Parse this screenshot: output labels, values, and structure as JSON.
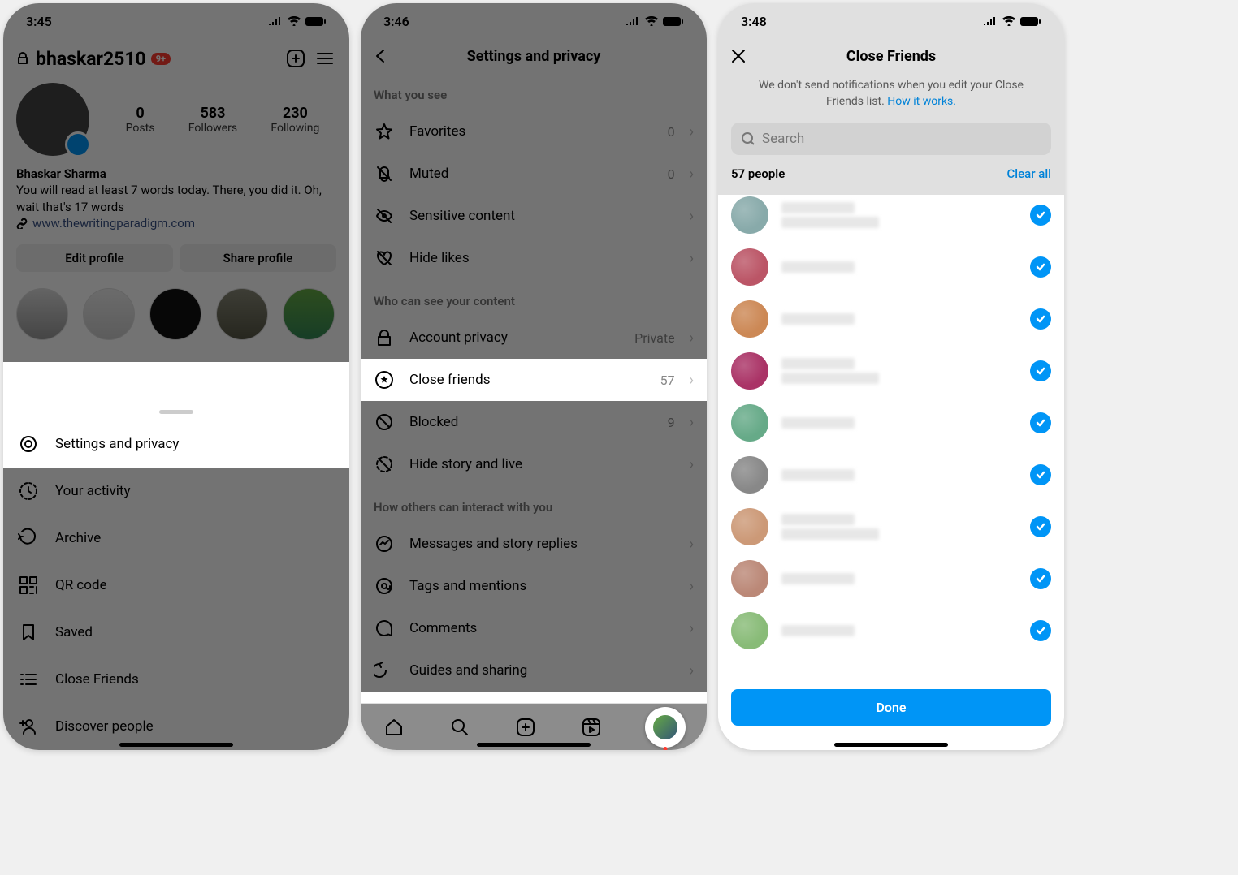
{
  "phone1": {
    "time": "3:45",
    "username": "bhaskar2510",
    "badge": "9+",
    "stats": {
      "posts_num": "0",
      "posts_lbl": "Posts",
      "followers_num": "583",
      "followers_lbl": "Followers",
      "following_num": "230",
      "following_lbl": "Following"
    },
    "bio_name": "Bhaskar Sharma",
    "bio_text": "You will read at least 7 words today. There, you did it. Oh, wait that's 17 words",
    "bio_link": "www.thewritingparadigm.com",
    "edit_btn": "Edit profile",
    "share_btn": "Share profile",
    "menu": {
      "settings": "Settings and privacy",
      "activity": "Your activity",
      "archive": "Archive",
      "qr": "QR code",
      "saved": "Saved",
      "close_friends": "Close Friends",
      "discover": "Discover people"
    }
  },
  "phone2": {
    "time": "3:46",
    "title": "Settings and privacy",
    "section1": "What you see",
    "favorites": {
      "label": "Favorites",
      "val": "0"
    },
    "muted": {
      "label": "Muted",
      "val": "0"
    },
    "sensitive": {
      "label": "Sensitive content"
    },
    "hidelikes": {
      "label": "Hide likes"
    },
    "section2": "Who can see your content",
    "privacy": {
      "label": "Account privacy",
      "val": "Private"
    },
    "closefriends": {
      "label": "Close friends",
      "val": "57"
    },
    "blocked": {
      "label": "Blocked",
      "val": "9"
    },
    "hidestory": {
      "label": "Hide story and live"
    },
    "section3": "How others can interact with you",
    "messages": {
      "label": "Messages and story replies"
    },
    "tags": {
      "label": "Tags and mentions"
    },
    "comments": {
      "label": "Comments"
    },
    "guides": {
      "label": "Guides and sharing"
    }
  },
  "phone3": {
    "time": "3:48",
    "title": "Close Friends",
    "desc1": "We don't send notifications when you edit your Close Friends list. ",
    "desc_link": "How it works.",
    "search_placeholder": "Search",
    "count": "57 people",
    "clear": "Clear all",
    "done": "Done",
    "avatar_colors": [
      "#8aa",
      "#b56",
      "#c85",
      "#a36",
      "#6a8",
      "#888",
      "#c97",
      "#b87",
      "#8b7"
    ]
  }
}
